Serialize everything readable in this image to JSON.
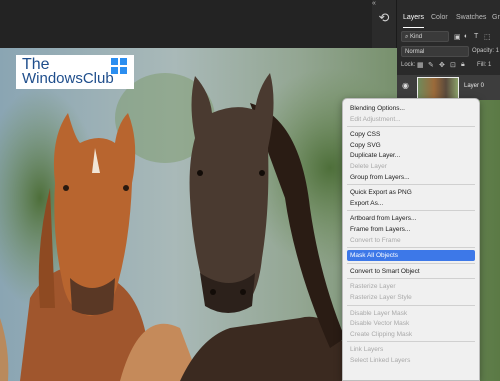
{
  "watermark": {
    "line1": "The",
    "line2": "WindowsClub"
  },
  "panel": {
    "tabs": [
      "Layers",
      "Color",
      "Swatches",
      "Gr"
    ],
    "filter_value": "Kind",
    "blend_mode": "Normal",
    "opacity_label": "Opacity: 1",
    "lock_label": "Lock:",
    "fill_label": "Fill: 1",
    "layer_name": "Layer 0"
  },
  "menu": {
    "items": [
      {
        "label": "Blending Options...",
        "disabled": false
      },
      {
        "label": "Edit Adjustment...",
        "disabled": true
      },
      {
        "sep": true
      },
      {
        "label": "Copy CSS",
        "disabled": false
      },
      {
        "label": "Copy SVG",
        "disabled": false
      },
      {
        "label": "Duplicate Layer...",
        "disabled": false
      },
      {
        "label": "Delete Layer",
        "disabled": true
      },
      {
        "label": "Group from Layers...",
        "disabled": false
      },
      {
        "sep": true
      },
      {
        "label": "Quick Export as PNG",
        "disabled": false
      },
      {
        "label": "Export As...",
        "disabled": false
      },
      {
        "sep": true
      },
      {
        "label": "Artboard from Layers...",
        "disabled": false
      },
      {
        "label": "Frame from Layers...",
        "disabled": false
      },
      {
        "label": "Convert to Frame",
        "disabled": true
      },
      {
        "sep": true
      },
      {
        "label": "Mask All Objects",
        "disabled": false,
        "selected": true
      },
      {
        "sep": true
      },
      {
        "label": "Convert to Smart Object",
        "disabled": false
      },
      {
        "sep": true
      },
      {
        "label": "Rasterize Layer",
        "disabled": true
      },
      {
        "label": "Rasterize Layer Style",
        "disabled": true
      },
      {
        "sep": true
      },
      {
        "label": "Disable Layer Mask",
        "disabled": true
      },
      {
        "label": "Disable Vector Mask",
        "disabled": true
      },
      {
        "label": "Create Clipping Mask",
        "disabled": true
      },
      {
        "sep": true
      },
      {
        "label": "Link Layers",
        "disabled": true
      },
      {
        "label": "Select Linked Layers",
        "disabled": true
      }
    ]
  },
  "colors": {
    "selection": "#3d78e8",
    "menu_bg": "#f0f0f0",
    "panel_bg": "#2a2a2a"
  }
}
